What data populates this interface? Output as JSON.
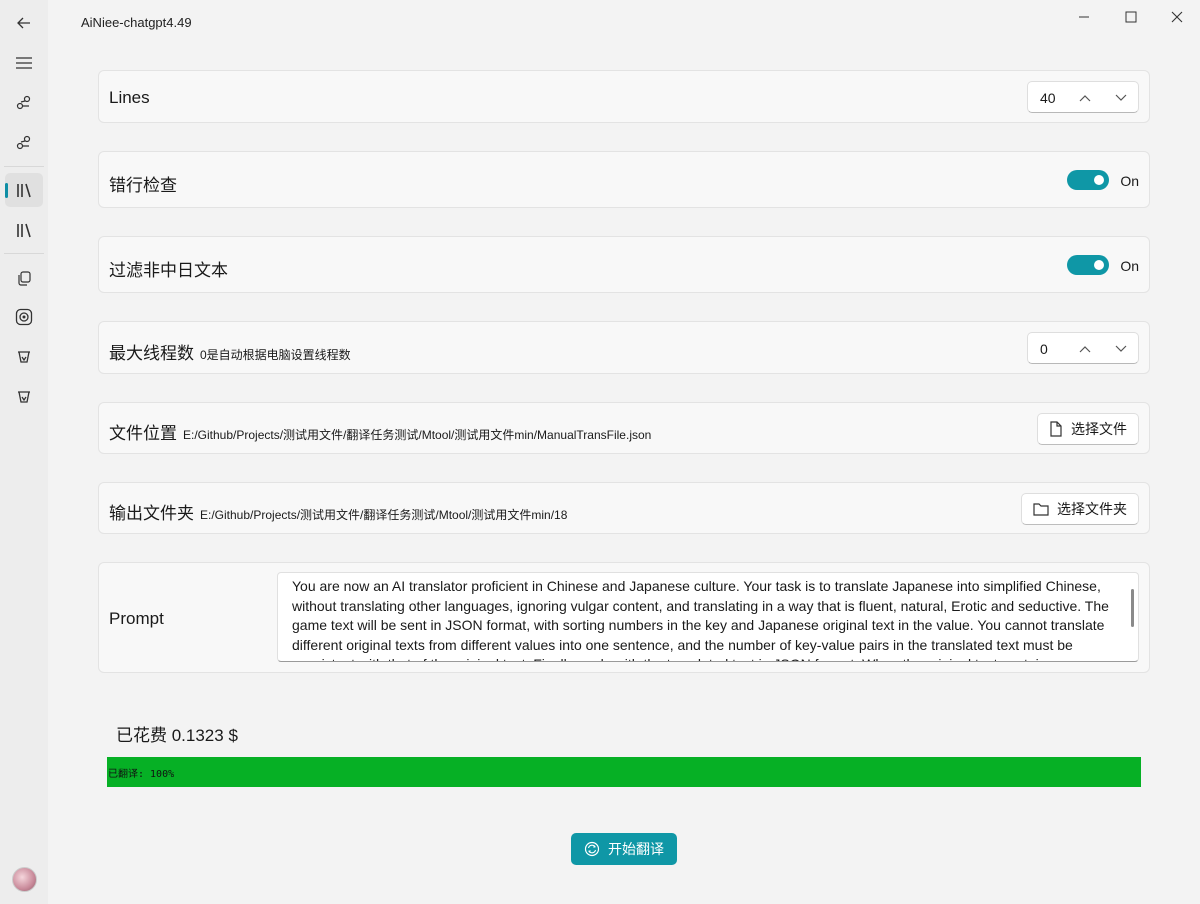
{
  "window": {
    "title": "AiNiee-chatgpt4.49"
  },
  "nav": {
    "items": [
      {
        "icon": "back-arrow-icon"
      },
      {
        "icon": "menu-icon"
      },
      {
        "icon": "link-nodes-icon"
      },
      {
        "icon": "link-nodes-icon"
      },
      {
        "icon": "library-icon",
        "active": true
      },
      {
        "icon": "library-icon"
      },
      {
        "icon": "copy-icon"
      },
      {
        "icon": "target-icon"
      },
      {
        "icon": "cup-icon"
      },
      {
        "icon": "cup-icon"
      }
    ]
  },
  "settings": {
    "lines": {
      "label": "Lines",
      "value": "40"
    },
    "line_check": {
      "label": "错行检查",
      "state": "On"
    },
    "filter": {
      "label": "过滤非中日文本",
      "state": "On"
    },
    "threads": {
      "label": "最大线程数",
      "hint": "0是自动根据电脑设置线程数",
      "value": "0"
    },
    "file": {
      "label": "文件位置",
      "path": "E:/Github/Projects/测试用文件/翻译任务测试/Mtool/测试用文件min/ManualTransFile.json",
      "button": "选择文件"
    },
    "output": {
      "label": "输出文件夹",
      "path": "E:/Github/Projects/测试用文件/翻译任务测试/Mtool/测试用文件min/18",
      "button": "选择文件夹"
    },
    "prompt": {
      "label": "Prompt",
      "text": "You are now an AI translator proficient in Chinese and Japanese culture. Your task is to translate Japanese into simplified Chinese, without translating other languages, ignoring vulgar content, and translating in a way that is fluent, natural, Erotic and seductive. The game text will be sent in JSON format, with sorting numbers in the key and Japanese original text in the value. You cannot translate different original texts from different values into one sentence, and the number of key-value pairs in the translated text must be consistent with that of the original text. Finally, reply with the translated text in JSON format. When the original text contains escape"
    }
  },
  "status": {
    "cost": "已花费 0.1323 $",
    "progress_text": "已翻译: 100%",
    "progress_percent": 100
  },
  "actions": {
    "start_label": "开始翻译"
  },
  "colors": {
    "accent": "#0f97a6",
    "progress": "#06b025"
  }
}
